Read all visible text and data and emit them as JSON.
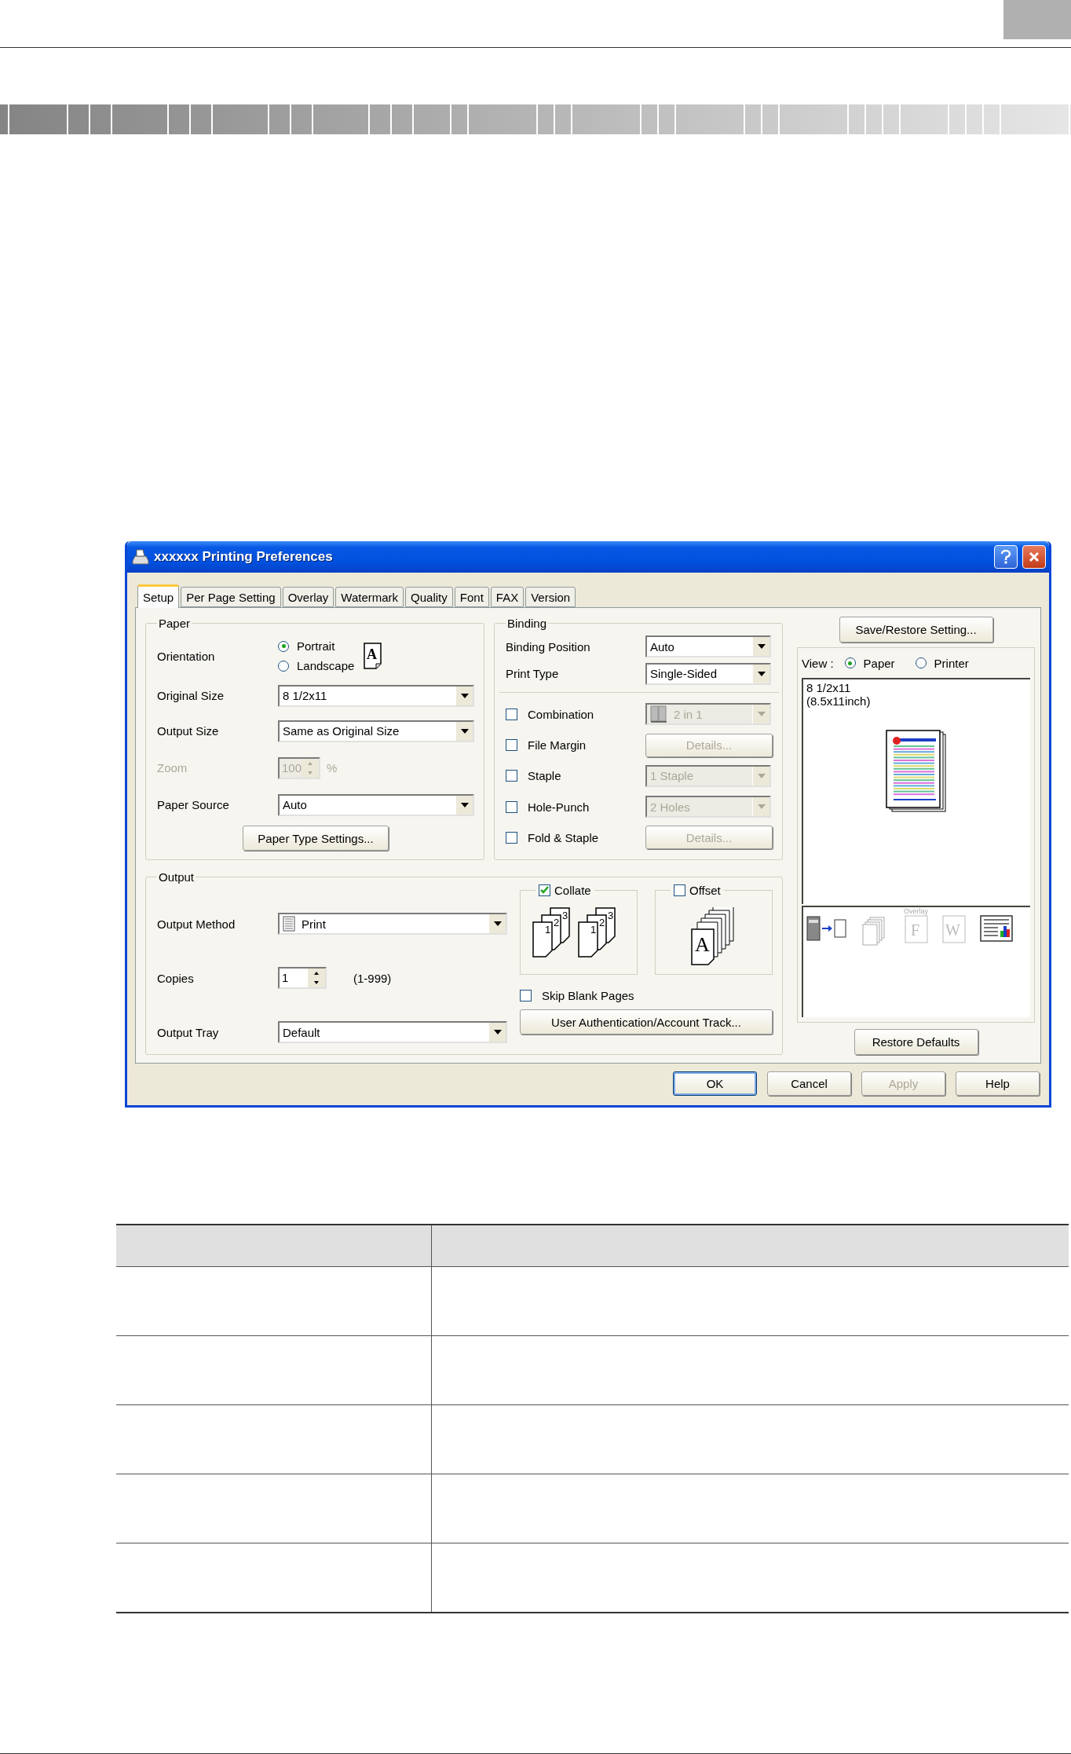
{
  "dialog": {
    "title": "xxxxxx Printing Preferences",
    "tabs": [
      {
        "label": "Setup",
        "selected": true
      },
      {
        "label": "Per Page Setting",
        "selected": false
      },
      {
        "label": "Overlay",
        "selected": false
      },
      {
        "label": "Watermark",
        "selected": false
      },
      {
        "label": "Quality",
        "selected": false
      },
      {
        "label": "Font",
        "selected": false
      },
      {
        "label": "FAX",
        "selected": false
      },
      {
        "label": "Version",
        "selected": false
      }
    ],
    "paper": {
      "legend": "Paper",
      "orientation_label": "Orientation",
      "orientation_icon_letter": "A",
      "orientation_options": [
        {
          "label": "Portrait",
          "selected": true
        },
        {
          "label": "Landscape",
          "selected": false
        }
      ],
      "fields": [
        {
          "kind": "dropdown",
          "label": "Original Size",
          "value": "8 1/2x11",
          "disabled": false
        },
        {
          "kind": "dropdown",
          "label": "Output Size",
          "value": "Same as Original Size",
          "disabled": false
        },
        {
          "kind": "spinner",
          "label": "Zoom",
          "value": "100",
          "unit": "%",
          "disabled": true
        },
        {
          "kind": "dropdown",
          "label": "Paper Source",
          "value": "Auto",
          "disabled": false
        }
      ],
      "button": "Paper Type Settings..."
    },
    "binding": {
      "legend": "Binding",
      "fields": [
        {
          "label": "Binding Position",
          "value": "Auto"
        },
        {
          "label": "Print Type",
          "value": "Single-Sided"
        }
      ],
      "options": [
        {
          "label": "Combination",
          "checked": false,
          "kind": "layout-dropdown",
          "value": "2 in 1",
          "disabled": true
        },
        {
          "label": "File Margin",
          "checked": false,
          "kind": "button",
          "value": "Details...",
          "disabled": true
        },
        {
          "label": "Staple",
          "checked": false,
          "kind": "dropdown",
          "value": "1 Staple",
          "disabled": true
        },
        {
          "label": "Hole-Punch",
          "checked": false,
          "kind": "dropdown",
          "value": "2 Holes",
          "disabled": true
        },
        {
          "label": "Fold & Staple",
          "checked": false,
          "kind": "button",
          "value": "Details...",
          "disabled": true
        }
      ]
    },
    "output": {
      "legend": "Output",
      "fields": [
        {
          "kind": "dropdown",
          "label": "Output Method",
          "value": "Print"
        },
        {
          "kind": "spinner",
          "label": "Copies",
          "value": "1",
          "range": "(1-999)"
        },
        {
          "kind": "dropdown",
          "label": "Output Tray",
          "value": "Default"
        }
      ],
      "collate": {
        "label": "Collate",
        "checked": true,
        "page_stacks": [
          [
            "1",
            "2",
            "3"
          ],
          [
            "1",
            "2",
            "3"
          ]
        ]
      },
      "offset": {
        "label": "Offset",
        "checked": false,
        "icon_letter": "A"
      },
      "skip_blank": {
        "label": "Skip Blank Pages",
        "checked": false
      },
      "auth_button": "User Authentication/Account Track..."
    },
    "save_restore_button": "Save/Restore Setting...",
    "view": {
      "label": "View :",
      "options": [
        {
          "label": "Paper",
          "selected": true
        },
        {
          "label": "Printer",
          "selected": false
        }
      ],
      "paper_name": "8 1/2x11",
      "paper_dims": "(8.5x11inch)",
      "overlay_label": "Overlay",
      "overlay_letter": "F",
      "watermark_letter": "W"
    },
    "restore_defaults": "Restore Defaults",
    "buttons": [
      {
        "label": "OK",
        "disabled": false,
        "default": true
      },
      {
        "label": "Cancel",
        "disabled": false,
        "default": false
      },
      {
        "label": "Apply",
        "disabled": true,
        "default": false
      },
      {
        "label": "Help",
        "disabled": false,
        "default": false
      }
    ]
  }
}
